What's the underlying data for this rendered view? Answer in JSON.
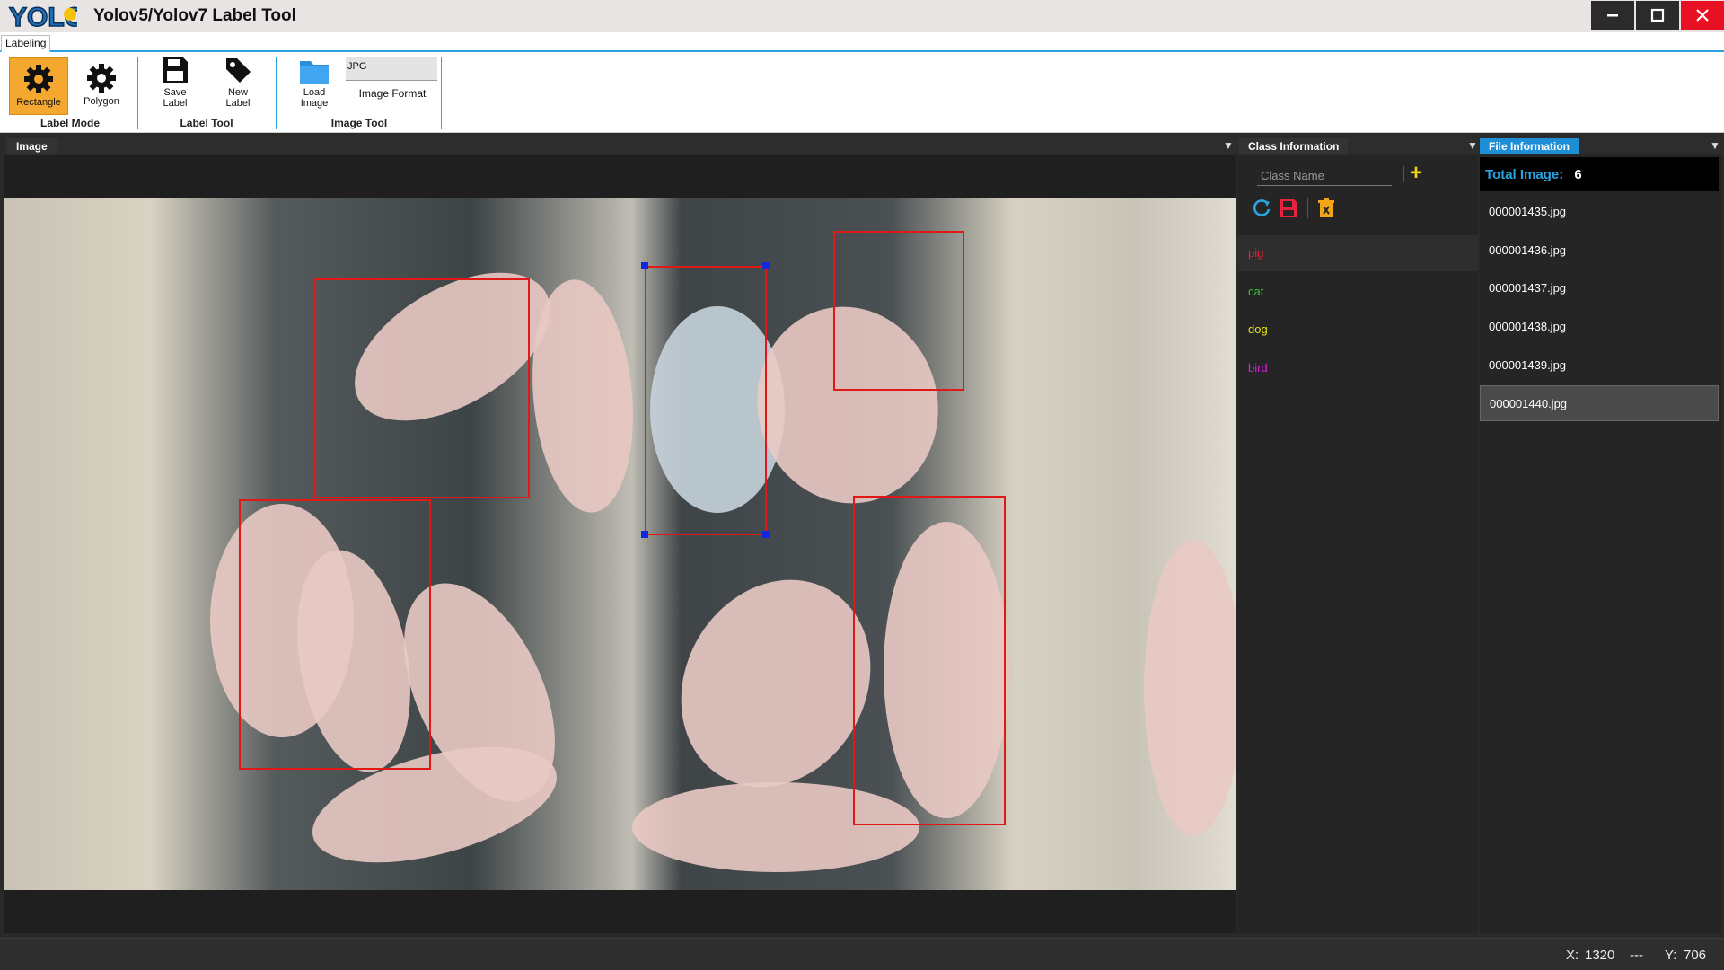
{
  "window": {
    "title": "Yolov5/Yolov7 Label Tool"
  },
  "ribbon": {
    "tab": "Labeling",
    "groups": {
      "label_mode": "Label Mode",
      "label_tool": "Label Tool",
      "image_tool": "Image Tool"
    },
    "buttons": {
      "rectangle": "Rectangle",
      "polygon": "Polygon",
      "save_label": "Save\nLabel",
      "new_label": "New\nLabel",
      "load_image": "Load\nImage",
      "image_format": "Image Format"
    },
    "format_value": "JPG"
  },
  "panels": {
    "image": "Image",
    "class_info": "Class Information",
    "file_info": "File Information"
  },
  "class_panel": {
    "placeholder": "Class Name",
    "classes": [
      {
        "name": "pig",
        "color": "#e8232d"
      },
      {
        "name": "cat",
        "color": "#3fbf3f"
      },
      {
        "name": "dog",
        "color": "#e6e21a"
      },
      {
        "name": "bird",
        "color": "#d422d8"
      }
    ]
  },
  "file_panel": {
    "total_label": "Total Image:",
    "total_value": "6",
    "files": [
      "000001435.jpg",
      "000001436.jpg",
      "000001437.jpg",
      "000001438.jpg",
      "000001439.jpg",
      "000001440.jpg"
    ],
    "selected_index": 5
  },
  "status": {
    "x_label": "X:",
    "x_value": "1320",
    "sep": "---",
    "y_label": "Y:",
    "y_value": "706"
  },
  "colors": {
    "accent": "#29a3e0",
    "bbox": "#e01818",
    "handle": "#1029e0",
    "close": "#e81123"
  },
  "icons": {
    "minimize": "minimize-icon",
    "maximize": "maximize-icon",
    "close": "close-icon"
  }
}
